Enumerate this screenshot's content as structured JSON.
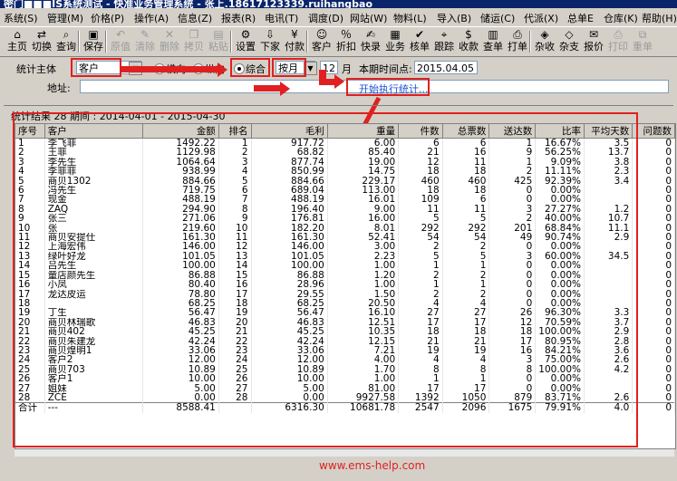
{
  "window": {
    "title": "密门■■■IS系统测试 - 快准业务管理系统 - 张上.18617123339.ruihangbao"
  },
  "menu": [
    "系统(S)",
    "管理(M)",
    "价格(P)",
    "操作(A)",
    "信息(Z)",
    "报表(R)",
    "电讯(T)",
    "调度(D)",
    "网站(W)",
    "物料(L)",
    "导入(B)",
    "储运(C)",
    "代派(X)",
    "总单E",
    "仓库(K)",
    "帮助(H)"
  ],
  "toolbar": [
    {
      "label": "主页",
      "icon": "home-icon",
      "glyph": "⌂",
      "disabled": false
    },
    {
      "label": "切换",
      "icon": "switch-icon",
      "glyph": "⇄",
      "disabled": false
    },
    {
      "label": "查询",
      "icon": "search-icon",
      "glyph": "⌕",
      "disabled": false
    },
    {
      "label": "保存",
      "icon": "save-icon",
      "glyph": "▣",
      "disabled": false
    },
    {
      "label": "原值",
      "icon": "undo-icon",
      "glyph": "↶",
      "disabled": true
    },
    {
      "label": "清除",
      "icon": "clear-icon",
      "glyph": "✎",
      "disabled": true
    },
    {
      "label": "删除",
      "icon": "delete-icon",
      "glyph": "✕",
      "disabled": true
    },
    {
      "label": "拷贝",
      "icon": "copy-icon",
      "glyph": "❐",
      "disabled": true
    },
    {
      "label": "粘贴",
      "icon": "paste-icon",
      "glyph": "▤",
      "disabled": true
    },
    {
      "label": "设置",
      "icon": "gear-icon",
      "glyph": "⚙",
      "disabled": false
    },
    {
      "label": "下家",
      "icon": "downstream-icon",
      "glyph": "⇩",
      "disabled": false
    },
    {
      "label": "付款",
      "icon": "payment-icon",
      "glyph": "¥",
      "disabled": false
    },
    {
      "label": "客户",
      "icon": "customer-icon",
      "glyph": "☺",
      "disabled": false
    },
    {
      "label": "折扣",
      "icon": "discount-icon",
      "glyph": "％",
      "disabled": false
    },
    {
      "label": "快录",
      "icon": "quick-entry-icon",
      "glyph": "✍",
      "disabled": false
    },
    {
      "label": "业务",
      "icon": "business-icon",
      "glyph": "▦",
      "disabled": false
    },
    {
      "label": "核单",
      "icon": "check-order-icon",
      "glyph": "✔",
      "disabled": false
    },
    {
      "label": "跟踪",
      "icon": "track-icon",
      "glyph": "⌖",
      "disabled": false
    },
    {
      "label": "收款",
      "icon": "receive-icon",
      "glyph": "$",
      "disabled": false
    },
    {
      "label": "查单",
      "icon": "query-order-icon",
      "glyph": "▥",
      "disabled": false
    },
    {
      "label": "打单",
      "icon": "print-order-icon",
      "glyph": "⎙",
      "disabled": false
    },
    {
      "label": "杂收",
      "icon": "misc-income-icon",
      "glyph": "◈",
      "disabled": false
    },
    {
      "label": "杂支",
      "icon": "misc-expense-icon",
      "glyph": "◇",
      "disabled": false
    },
    {
      "label": "报价",
      "icon": "quote-icon",
      "glyph": "✉",
      "disabled": false
    },
    {
      "label": "打印",
      "icon": "printer-icon",
      "glyph": "⎙",
      "disabled": true
    },
    {
      "label": "重单",
      "icon": "duplicate-icon",
      "glyph": "⧉",
      "disabled": true
    }
  ],
  "filter": {
    "subject_label": "统计主体",
    "subject_value": "客户",
    "radio_horizontal": "横向",
    "radio_vertical": "纵向",
    "radio_combined": "综合",
    "period_value": "按月",
    "months_value": "12",
    "months_unit": "月",
    "period_point_label": "本期时间点:",
    "period_point_value": "2015.04.05",
    "address_label": "地址:",
    "address_value": "",
    "run_button": "开始执行统计..."
  },
  "stats": {
    "text": "统计结果  28  期间 : 2014-04-01 - 2015-04-30"
  },
  "columns": [
    "序号",
    "客户",
    "金额",
    "排名",
    "毛利",
    "重量",
    "件数",
    "总票数",
    "送达数",
    "比率",
    "平均天数",
    "问题数"
  ],
  "rows": [
    [
      "1",
      "李飞菲",
      "1492.22",
      "1",
      "917.72",
      "6.00",
      "6",
      "6",
      "1",
      "16.67%",
      "3.5",
      "0"
    ],
    [
      "2",
      "王菲",
      "1129.98",
      "2",
      "68.82",
      "85.40",
      "21",
      "16",
      "9",
      "56.25%",
      "13.7",
      "0"
    ],
    [
      "3",
      "李先生",
      "1064.64",
      "3",
      "877.74",
      "19.00",
      "12",
      "11",
      "1",
      "9.09%",
      "3.8",
      "0"
    ],
    [
      "4",
      "李菲菲",
      "938.99",
      "4",
      "850.99",
      "14.75",
      "18",
      "18",
      "2",
      "11.11%",
      "2.3",
      "0"
    ],
    [
      "5",
      "商贝1302",
      "884.66",
      "5",
      "884.66",
      "229.17",
      "460",
      "460",
      "425",
      "92.39%",
      "3.4",
      "0"
    ],
    [
      "6",
      "冯先生",
      "719.75",
      "6",
      "689.04",
      "113.00",
      "18",
      "18",
      "0",
      "0.00%",
      "",
      "0"
    ],
    [
      "7",
      "现金",
      "488.19",
      "7",
      "488.19",
      "16.01",
      "109",
      "6",
      "0",
      "0.00%",
      "",
      "0"
    ],
    [
      "8",
      "ZAQ",
      "294.90",
      "8",
      "196.40",
      "9.00",
      "11",
      "11",
      "3",
      "27.27%",
      "1.2",
      "0"
    ],
    [
      "9",
      "张三",
      "271.06",
      "9",
      "176.81",
      "16.00",
      "5",
      "5",
      "2",
      "40.00%",
      "10.7",
      "0"
    ],
    [
      "10",
      "张",
      "219.60",
      "10",
      "182.20",
      "8.01",
      "292",
      "292",
      "201",
      "68.84%",
      "11.1",
      "0"
    ],
    [
      "11",
      "商贝安提仕",
      "161.30",
      "11",
      "161.30",
      "52.41",
      "54",
      "54",
      "49",
      "90.74%",
      "2.9",
      "0"
    ],
    [
      "12",
      "上海宏伟",
      "146.00",
      "12",
      "146.00",
      "3.00",
      "2",
      "2",
      "0",
      "0.00%",
      "",
      "0"
    ],
    [
      "13",
      "绿叶好龙",
      "101.05",
      "13",
      "101.05",
      "2.23",
      "5",
      "5",
      "3",
      "60.00%",
      "34.5",
      "0"
    ],
    [
      "14",
      "吕先生",
      "100.00",
      "14",
      "100.00",
      "1.00",
      "1",
      "1",
      "0",
      "0.00%",
      "",
      "0"
    ],
    [
      "15",
      "童店颜先生",
      "86.88",
      "15",
      "86.88",
      "1.20",
      "2",
      "2",
      "0",
      "0.00%",
      "",
      "0"
    ],
    [
      "16",
      "小凤",
      "80.40",
      "16",
      "28.96",
      "1.00",
      "1",
      "1",
      "0",
      "0.00%",
      "",
      "0"
    ],
    [
      "17",
      "龙达皮运",
      "78.80",
      "17",
      "29.55",
      "1.50",
      "2",
      "2",
      "0",
      "0.00%",
      "",
      "0"
    ],
    [
      "18",
      "",
      "68.25",
      "18",
      "68.25",
      "20.50",
      "4",
      "4",
      "0",
      "0.00%",
      "",
      "0"
    ],
    [
      "19",
      "丁生",
      "56.47",
      "19",
      "56.47",
      "16.10",
      "27",
      "27",
      "26",
      "96.30%",
      "3.3",
      "0"
    ],
    [
      "20",
      "商贝林瑞歌",
      "46.83",
      "20",
      "46.83",
      "12.51",
      "17",
      "17",
      "12",
      "70.59%",
      "3.7",
      "0"
    ],
    [
      "21",
      "商贝402",
      "45.25",
      "21",
      "45.25",
      "10.35",
      "18",
      "18",
      "18",
      "100.00%",
      "2.9",
      "0"
    ],
    [
      "22",
      "商贝朱建龙",
      "42.24",
      "22",
      "42.24",
      "12.15",
      "21",
      "21",
      "17",
      "80.95%",
      "2.8",
      "0"
    ],
    [
      "23",
      "商贝煌明1",
      "33.06",
      "23",
      "33.06",
      "7.21",
      "19",
      "19",
      "16",
      "84.21%",
      "3.6",
      "0"
    ],
    [
      "24",
      "客户2",
      "12.00",
      "24",
      "12.00",
      "4.00",
      "4",
      "4",
      "3",
      "75.00%",
      "2.6",
      "0"
    ],
    [
      "25",
      "商贝703",
      "10.89",
      "25",
      "10.89",
      "1.70",
      "8",
      "8",
      "8",
      "100.00%",
      "4.2",
      "0"
    ],
    [
      "26",
      "客户1",
      "10.00",
      "26",
      "10.00",
      "1.00",
      "1",
      "1",
      "0",
      "0.00%",
      "",
      "0"
    ],
    [
      "27",
      "姐妹",
      "5.00",
      "27",
      "5.00",
      "81.00",
      "17",
      "17",
      "0",
      "0.00%",
      "",
      "0"
    ],
    [
      "28",
      "ZCE",
      "0.00",
      "28",
      "0.00",
      "9927.58",
      "1392",
      "1050",
      "879",
      "83.71%",
      "2.6",
      "0"
    ]
  ],
  "total": [
    "合计",
    "---",
    "8588.41",
    "",
    "6316.30",
    "10681.78",
    "2547",
    "2096",
    "1675",
    "79.91%",
    "4.0",
    "0"
  ],
  "watermark": "www.ems-help.com",
  "colors": {
    "annotation_red": "#e02020",
    "link_blue": "#1c4fd6",
    "title_bar": "#0a246a"
  }
}
